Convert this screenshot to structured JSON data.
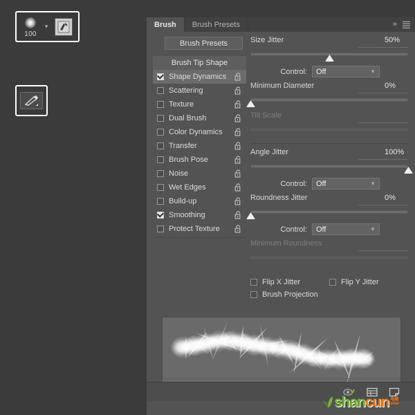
{
  "toolbar": {
    "brush_size": "100",
    "brush_preset_icon": "soft-round-brush-thumbnail",
    "chevron_icon": "chevron-down-icon",
    "tablet_pressure_icon": "tablet-pressure-icon",
    "brush_tool_icon": "brush-tool-icon"
  },
  "panel": {
    "tabs": [
      {
        "label": "Brush",
        "active": true
      },
      {
        "label": "Brush Presets",
        "active": false
      }
    ],
    "expand_icon": "double-chevron-right-icon",
    "menu_icon": "panel-menu-icon"
  },
  "left": {
    "presets_button": "Brush Presets",
    "tip_shape": "Brush Tip Shape",
    "lock_icon": "padlock-open-icon",
    "options": [
      {
        "label": "Shape Dynamics",
        "checked": true,
        "selected": true
      },
      {
        "label": "Scattering",
        "checked": false,
        "selected": false
      },
      {
        "label": "Texture",
        "checked": false,
        "selected": false
      },
      {
        "label": "Dual Brush",
        "checked": false,
        "selected": false
      },
      {
        "label": "Color Dynamics",
        "checked": false,
        "selected": false
      },
      {
        "label": "Transfer",
        "checked": false,
        "selected": false
      },
      {
        "label": "Brush Pose",
        "checked": false,
        "selected": false
      },
      {
        "label": "Noise",
        "checked": false,
        "selected": false
      },
      {
        "label": "Wet Edges",
        "checked": false,
        "selected": false
      },
      {
        "label": "Build-up",
        "checked": false,
        "selected": false
      },
      {
        "label": "Smoothing",
        "checked": true,
        "selected": false
      },
      {
        "label": "Protect Texture",
        "checked": false,
        "selected": false
      }
    ]
  },
  "settings": {
    "size_jitter": {
      "label": "Size Jitter",
      "value": "50%",
      "pct": 50,
      "disabled": false
    },
    "size_control": {
      "label": "Control:",
      "value": "Off"
    },
    "minimum_diameter": {
      "label": "Minimum Diameter",
      "value": "0%",
      "pct": 0,
      "disabled": false
    },
    "tilt_scale": {
      "label": "Tilt Scale",
      "value": "",
      "pct": 0,
      "disabled": true
    },
    "angle_jitter": {
      "label": "Angle Jitter",
      "value": "100%",
      "pct": 100,
      "disabled": false
    },
    "angle_control": {
      "label": "Control:",
      "value": "Off"
    },
    "roundness_jitter": {
      "label": "Roundness Jitter",
      "value": "0%",
      "pct": 0,
      "disabled": false
    },
    "roundness_control": {
      "label": "Control:",
      "value": "Off"
    },
    "minimum_roundness": {
      "label": "Minimum Roundness",
      "value": "",
      "pct": 0,
      "disabled": true
    },
    "dropdown_icon": "chevron-down-icon"
  },
  "checkboxes": {
    "flip_x": {
      "label": "Flip X Jitter",
      "checked": false
    },
    "flip_y": {
      "label": "Flip Y Jitter",
      "checked": false
    },
    "projection": {
      "label": "Brush Projection",
      "checked": false
    }
  },
  "preview": {
    "name": "brush-stroke-preview"
  },
  "footer": {
    "icons": [
      {
        "name": "toggle-brush-preview-icon"
      },
      {
        "name": "brush-panel-grid-icon"
      },
      {
        "name": "new-brush-preset-icon"
      }
    ]
  },
  "watermark": {
    "part1": "shan",
    "part2": "cun",
    "tiny1": "电脑",
    "tiny2": "inter"
  },
  "colors": {
    "app_background": "#3b3b3b",
    "panel_background": "#535353",
    "panel_tabbar": "#414141",
    "selected_row": "#6b6b6b",
    "knob": "#f0f0f0",
    "text": "#dcdcdc",
    "text_disabled": "#7e7e7e"
  }
}
